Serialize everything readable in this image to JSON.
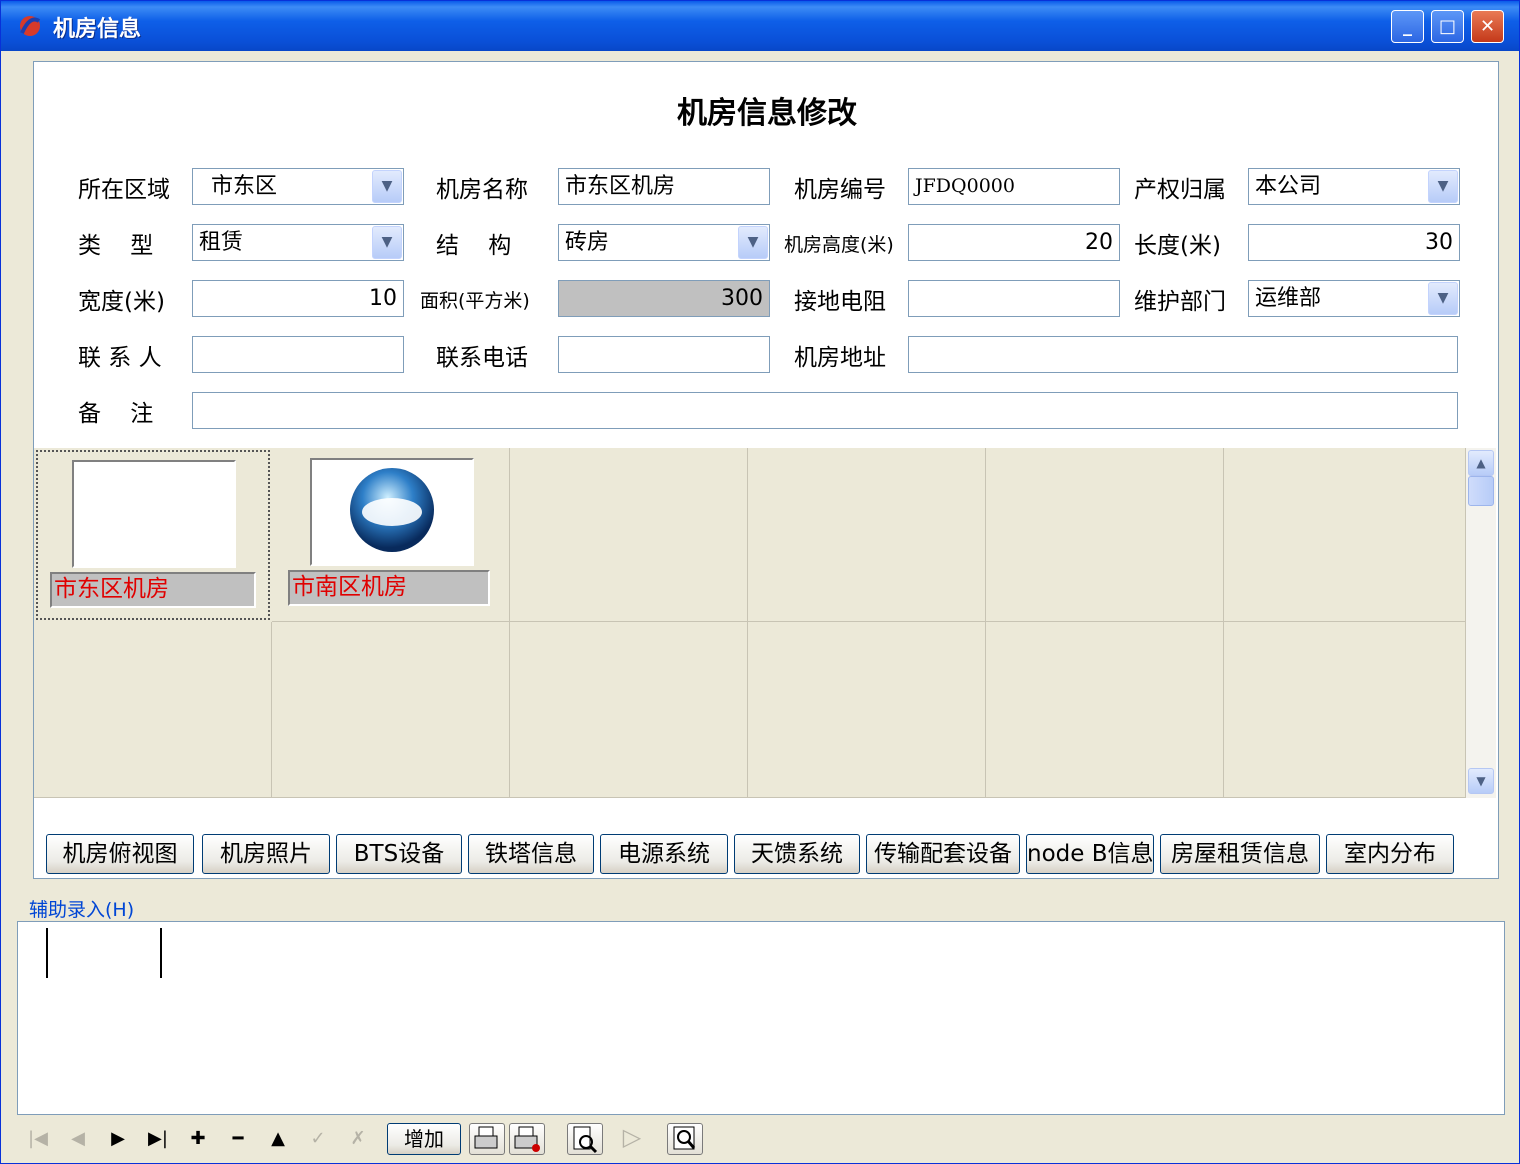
{
  "window": {
    "title": "机房信息"
  },
  "form": {
    "heading": "机房信息修改",
    "labels": {
      "region": "所在区域",
      "room_name": "机房名称",
      "room_no": "机房编号",
      "ownership": "产权归属",
      "type": "类    型",
      "structure": "结    构",
      "height": "机房高度(米)",
      "length": "长度(米)",
      "width": "宽度(米)",
      "area": "面积(平方米)",
      "ground_resistance": "接地电阻",
      "maint_dept": "维护部门",
      "contact": "联 系 人",
      "phone": "联系电话",
      "address": "机房地址",
      "remarks": "备    注"
    },
    "values": {
      "region": "市东区",
      "room_name": "市东区机房",
      "room_no": "JFDQ0000",
      "ownership": "本公司",
      "type": "租赁",
      "structure": "砖房",
      "height": "20",
      "length": "30",
      "width": "10",
      "area": "300",
      "ground_resistance": "",
      "maint_dept": "运维部",
      "contact": "",
      "phone": "",
      "address": "",
      "remarks": ""
    }
  },
  "gallery": {
    "items": [
      {
        "caption": "市东区机房"
      },
      {
        "caption": "市南区机房"
      }
    ]
  },
  "tabs": [
    "机房俯视图",
    "机房照片",
    "BTS设备",
    "铁塔信息",
    "电源系统",
    "天馈系统",
    "传输配套设备",
    "node B信息",
    "房屋租赁信息",
    "室内分布"
  ],
  "aux": {
    "legend": "辅助录入(H)"
  },
  "navbar": {
    "add_label": "增加"
  },
  "icons": {
    "first": "first-record-icon",
    "prior": "prior-record-icon",
    "next": "next-record-icon",
    "last": "last-record-icon",
    "insert": "insert-icon",
    "delete": "delete-icon",
    "edit": "edit-icon",
    "post": "post-icon",
    "cancel": "cancel-icon"
  },
  "colors": {
    "titlebar": "#0a50d8",
    "caption_text": "#e00000",
    "window_bg": "#ece9d8"
  }
}
